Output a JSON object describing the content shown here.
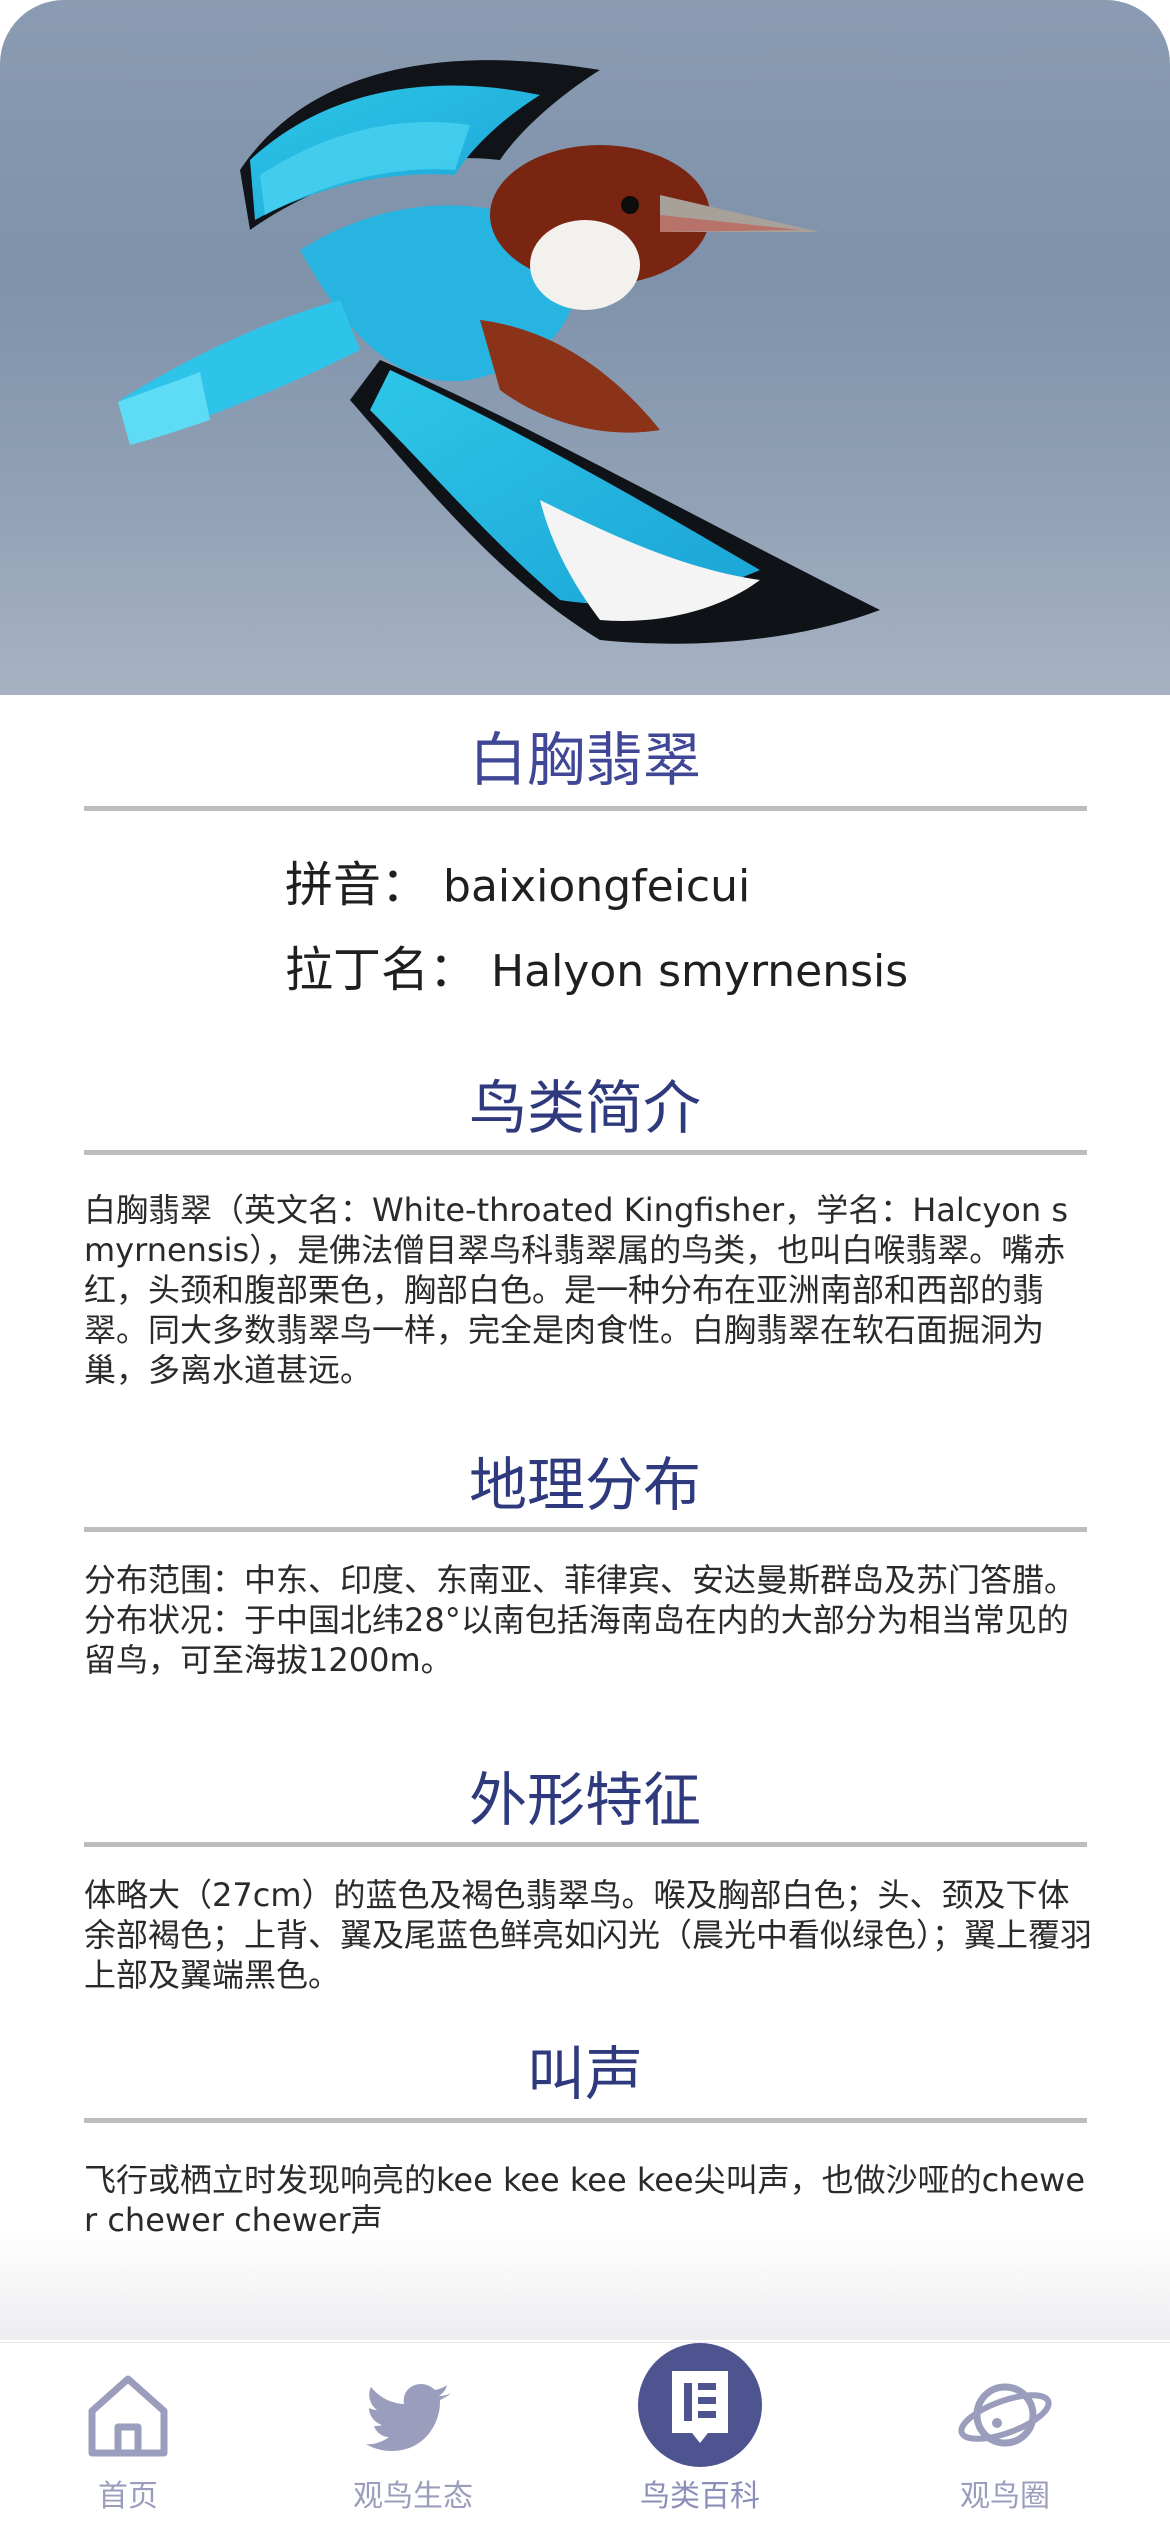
{
  "bird": {
    "name": "白胸翡翠",
    "pinyin_label": "拼音：",
    "pinyin_value": "baixiongfeicui",
    "latin_label": "拉丁名：",
    "latin_value": "Halyon smyrnensis"
  },
  "sections": {
    "intro": {
      "title": "鸟类简介",
      "text": "白胸翡翠（英文名：White-throated Kingfisher，学名：Halcyon smyrnensis），是佛法僧目翠鸟科翡翠属的鸟类，也叫白喉翡翠。嘴赤红，头颈和腹部栗色，胸部白色。是一种分布在亚洲南部和西部的翡翠。同大多数翡翠鸟一样，完全是肉食性。白胸翡翠在软石面掘洞为巢，多离水道甚远。"
    },
    "distribution": {
      "title": "地理分布",
      "text": "分布范围：中东、印度、东南亚、菲律宾、安达曼斯群岛及苏门答腊。分布状况：于中国北纬28°以南包括海南岛在内的大部分为相当常见的留鸟，可至海拔1200m。"
    },
    "appearance": {
      "title": "外形特征",
      "text": "体略大（27cm）的蓝色及褐色翡翠鸟。喉及胸部白色；头、颈及下体余部褐色；上背、翼及尾蓝色鲜亮如闪光（晨光中看似绿色）；翼上覆羽上部及翼端黑色。"
    },
    "call": {
      "title": "叫声",
      "text": "飞行或栖立时发现响亮的kee kee kee kee尖叫声，也做沙哑的chewer chewer chewer声"
    }
  },
  "tabbar": {
    "tabs": [
      {
        "label": "首页",
        "icon": "home-icon"
      },
      {
        "label": "观鸟生态",
        "icon": "bird-icon"
      },
      {
        "label": "鸟类百科",
        "icon": "book-icon",
        "active": true
      },
      {
        "label": "观鸟圈",
        "icon": "planet-icon"
      }
    ]
  },
  "colors": {
    "title": "#3f4796",
    "section_title": "#2e3a7d",
    "tab_inactive": "#9b9dbd",
    "tab_active_bg": "#4e548f",
    "rule": "#bdbdbd"
  }
}
